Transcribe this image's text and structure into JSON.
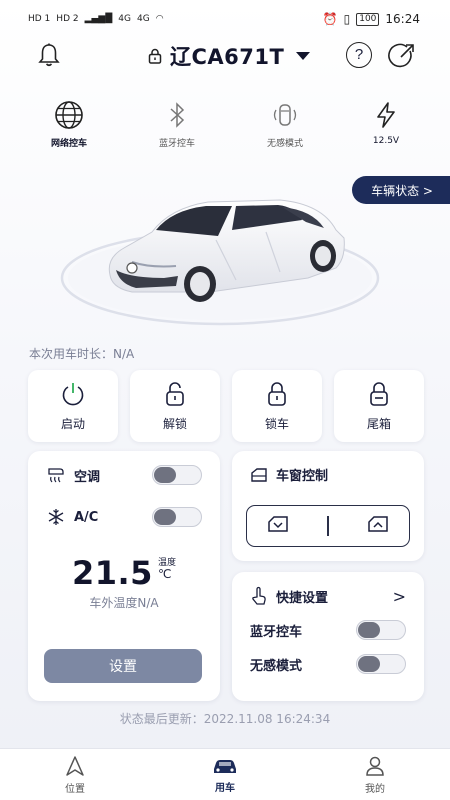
{
  "status_bar": {
    "left_labels": [
      "HD 1",
      "HD 2",
      "4G",
      "4G"
    ],
    "battery": "100",
    "time": "16:24"
  },
  "header": {
    "plate": "辽CA671T",
    "help_label": "?"
  },
  "modes": [
    {
      "label": "网络控车",
      "icon": "globe-icon",
      "active": true
    },
    {
      "label": "蓝牙控车",
      "icon": "bluetooth-icon",
      "active": false
    },
    {
      "label": "无感模式",
      "icon": "car-sensor-icon",
      "active": false
    },
    {
      "label": "12.5V",
      "icon": "lightning-icon",
      "active": false
    }
  ],
  "vehicle_status_button": "车辆状态 >",
  "usage_duration": "本次用车时长：N/A",
  "quick_actions": [
    {
      "label": "启动",
      "icon": "power-icon"
    },
    {
      "label": "解锁",
      "icon": "unlock-icon"
    },
    {
      "label": "锁车",
      "icon": "lock-icon"
    },
    {
      "label": "尾箱",
      "icon": "trunk-lock-icon"
    }
  ],
  "ac": {
    "aircon_label": "空调",
    "aircon_on": false,
    "ac_label": "A/C",
    "ac_on": false,
    "temperature": "21.5",
    "temp_caption": "温度",
    "temp_unit": "℃",
    "outside_temp": "车外温度N/A",
    "settings_button": "设置"
  },
  "window_control": {
    "title": "车窗控制"
  },
  "quick_settings": {
    "title": "快捷设置",
    "arrow": ">",
    "bluetooth_label": "蓝牙控车",
    "bluetooth_on": false,
    "sensorless_label": "无感模式",
    "sensorless_on": false
  },
  "last_update": "状态最后更新：2022.11.08 16:24:34",
  "tabs": [
    {
      "label": "位置",
      "icon": "location-icon",
      "active": false
    },
    {
      "label": "用车",
      "icon": "car-icon",
      "active": true
    },
    {
      "label": "我的",
      "icon": "user-icon",
      "active": false
    }
  ],
  "colors": {
    "accent": "#1d2c5a",
    "button_disabled": "#7d88a3",
    "muted_text": "#7a7f95"
  }
}
